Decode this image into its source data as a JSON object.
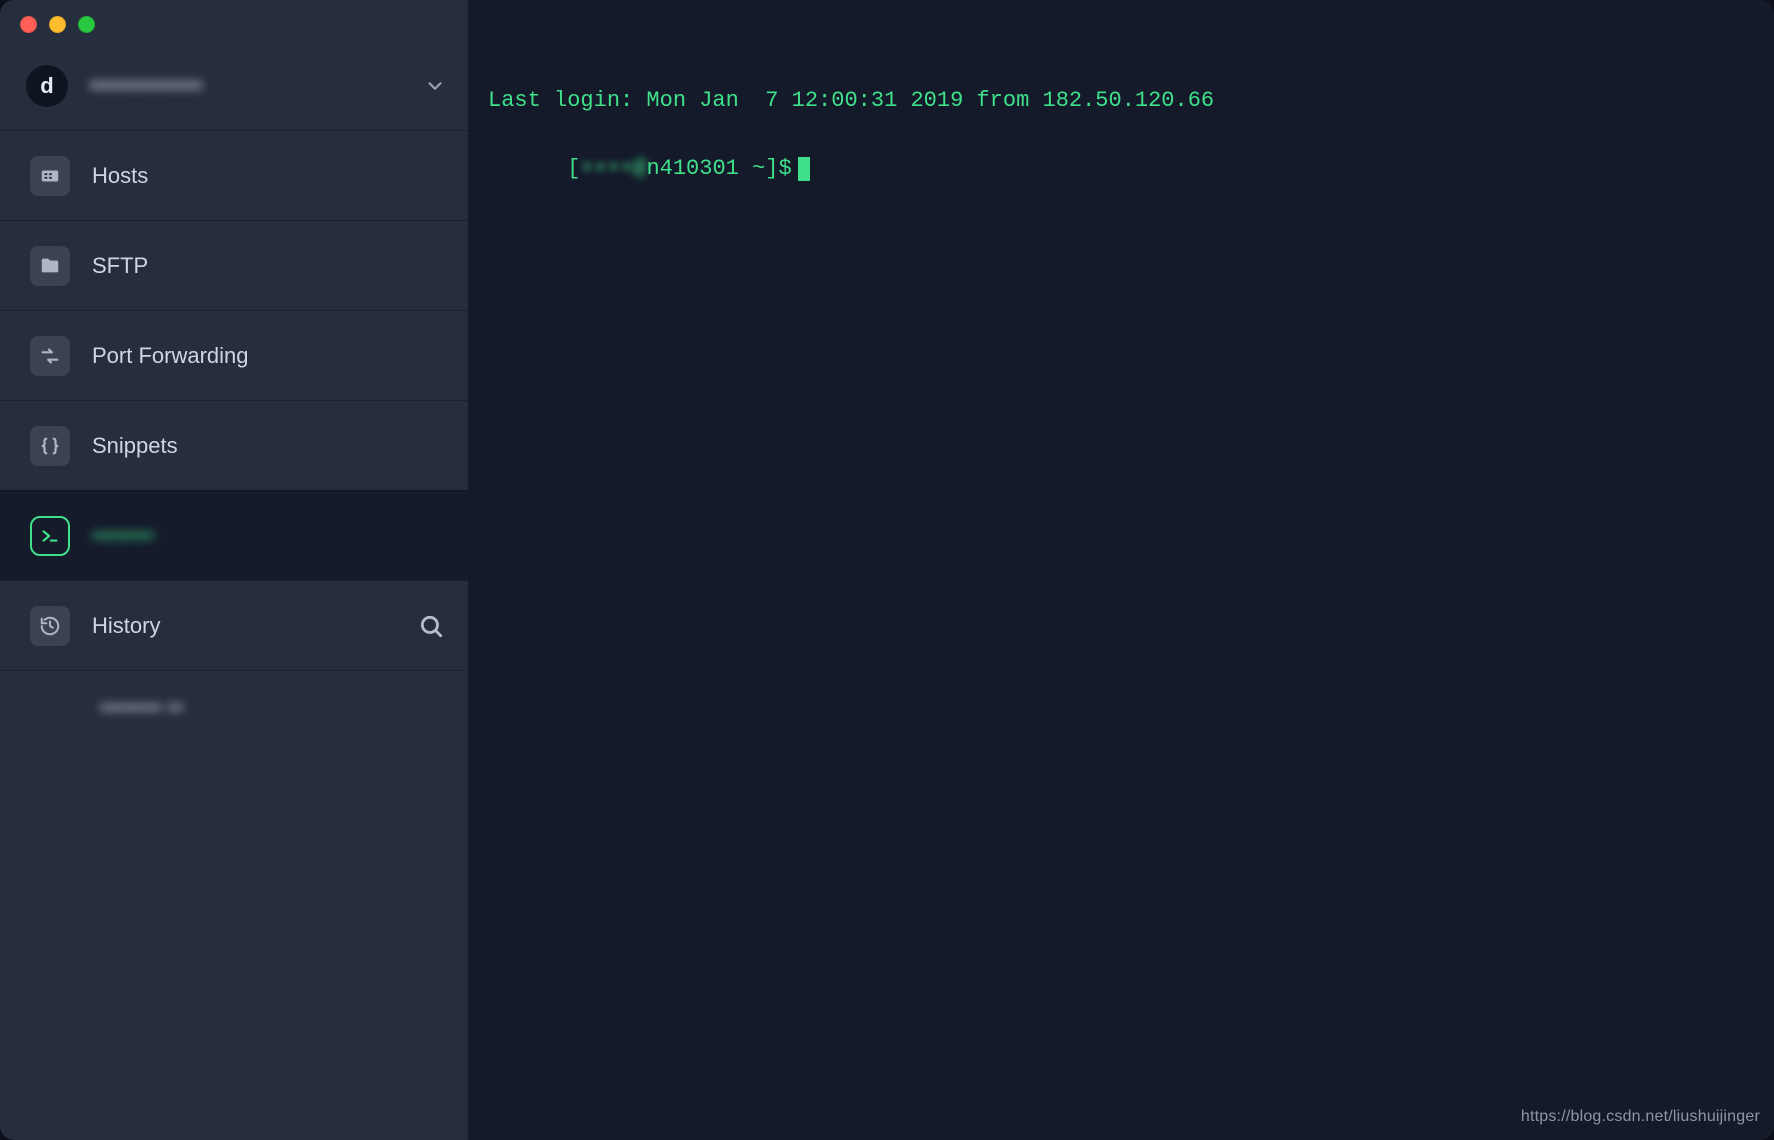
{
  "window": {
    "traffic": {
      "close": "close",
      "minimize": "minimize",
      "maximize": "maximize"
    }
  },
  "selector": {
    "avatar_glyph": "d",
    "label_obscured": "••••••••••••"
  },
  "sidebar": {
    "items": [
      {
        "key": "hosts",
        "label": "Hosts"
      },
      {
        "key": "sftp",
        "label": "SFTP"
      },
      {
        "key": "port-forwarding",
        "label": "Port Forwarding"
      },
      {
        "key": "snippets",
        "label": "Snippets"
      },
      {
        "key": "active-session",
        "label_obscured": "••••••••",
        "active": true
      },
      {
        "key": "history",
        "label": "History",
        "has_search": true
      }
    ],
    "history_entries": [
      {
        "label_obscured": "•••••••• ••"
      }
    ]
  },
  "terminal": {
    "last_login_line": "Last login: Mon Jan  7 12:00:31 2019 from 182.50.120.66",
    "prompt_prefix": "[",
    "prompt_user_obscured": "••••@",
    "prompt_host": "n410301",
    "prompt_path": "~",
    "prompt_suffix": "]$"
  },
  "watermark": "https://blog.csdn.net/liushuijinger",
  "colors": {
    "sidebar_bg": "#262d3d",
    "terminal_bg": "#141a2a",
    "accent_green": "#3fe08a"
  }
}
